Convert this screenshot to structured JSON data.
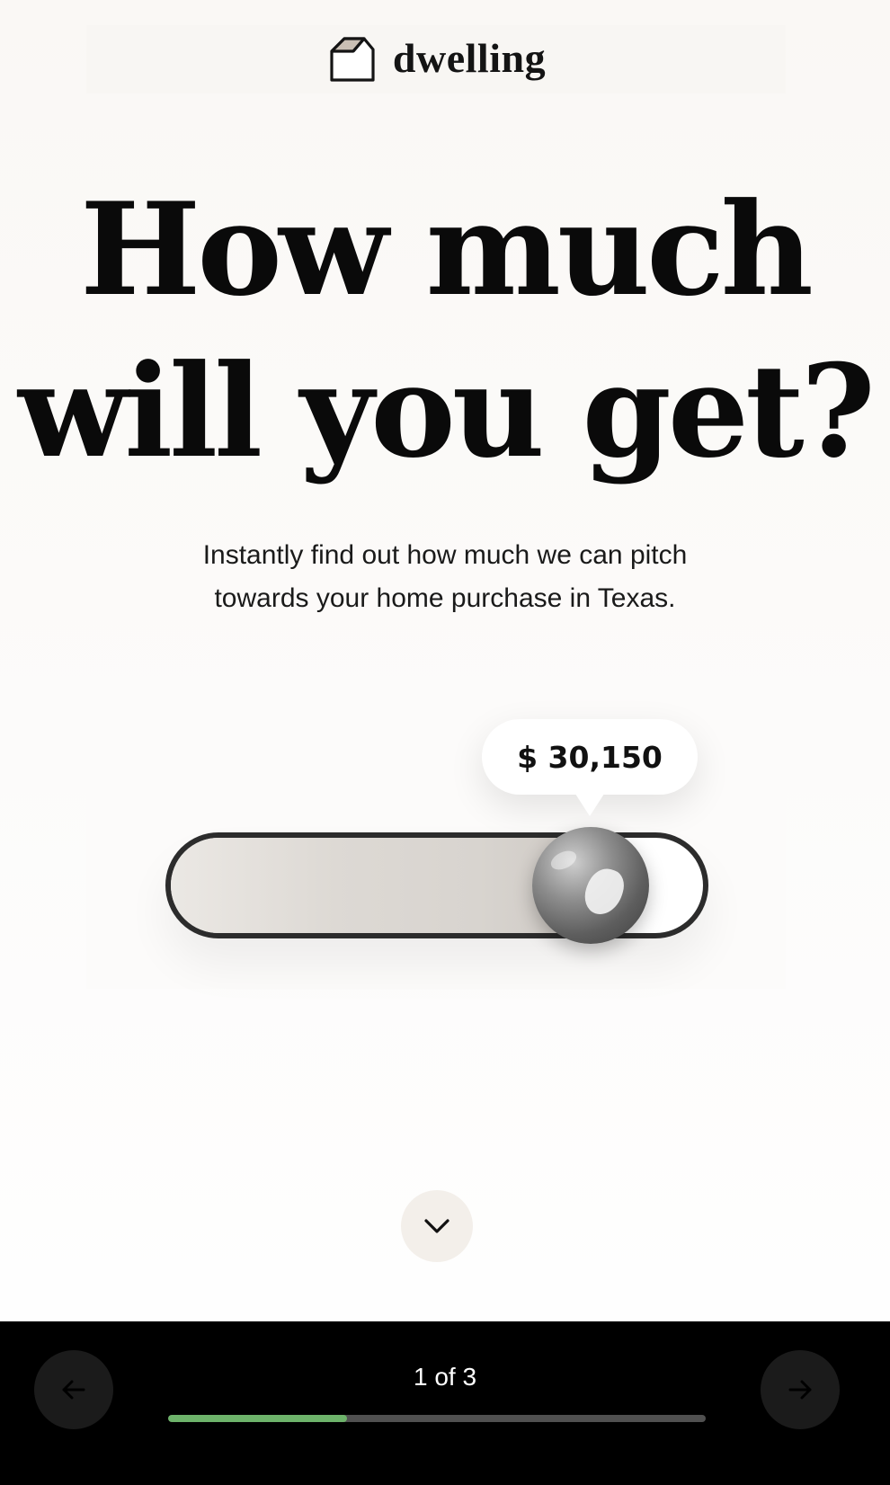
{
  "header": {
    "brand_name": "dwelling",
    "logo_icon": "house-outline-icon"
  },
  "hero": {
    "title_line1": "How much",
    "title_line2": "will you get?",
    "subtitle_line1": "Instantly find out how much we can pitch",
    "subtitle_line2": "towards your home purchase in Texas."
  },
  "slider": {
    "value_label": "$ 30,150",
    "value_fraction": 0.77
  },
  "scroll": {
    "icon": "chevron-down-icon"
  },
  "footer": {
    "page_counter": "1 of 3",
    "progress_fraction": 0.333,
    "prev_icon": "arrow-left-icon",
    "next_icon": "arrow-right-icon"
  },
  "colors": {
    "background": "#fbfaf8",
    "text": "#0d0d0d",
    "bottom_bar": "#000000",
    "progress_fill": "#6db36a",
    "progress_track": "#505050",
    "scroll_button": "#f3efea"
  }
}
